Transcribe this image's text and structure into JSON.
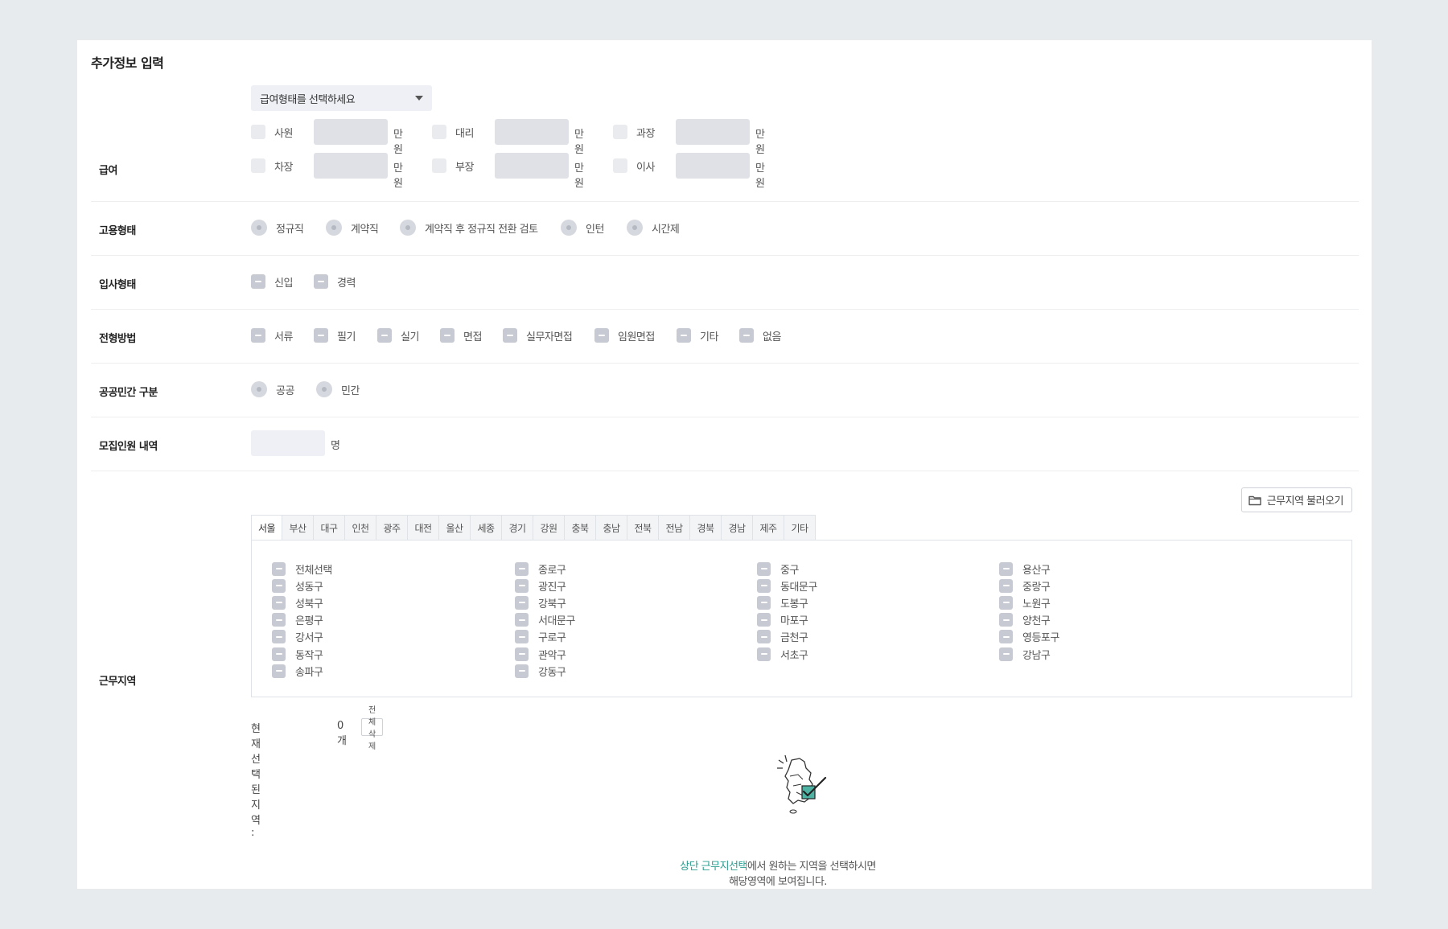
{
  "title": "추가정보 입력",
  "salary": {
    "label": "급여",
    "select_placeholder": "급여형태를 선택하세요",
    "unit": "만원",
    "ranks": [
      "사원",
      "대리",
      "과장",
      "차장",
      "부장",
      "이사"
    ]
  },
  "employment_type": {
    "label": "고용형태",
    "options": [
      "정규직",
      "계약직",
      "계약직 후 정규직 전환 검토",
      "인턴",
      "시간제"
    ]
  },
  "hire_type": {
    "label": "입사형태",
    "options": [
      "신입",
      "경력"
    ]
  },
  "screening": {
    "label": "전형방법",
    "options": [
      "서류",
      "필기",
      "실기",
      "면접",
      "실무자면접",
      "임원면접",
      "기타",
      "없음"
    ]
  },
  "sector": {
    "label": "공공민간 구분",
    "options": [
      "공공",
      "민간"
    ]
  },
  "recruit_count": {
    "label": "모집인원 내역",
    "unit": "명"
  },
  "work_region": {
    "label": "근무지역",
    "load_button": "근무지역 불러오기",
    "tabs": [
      "서울",
      "부산",
      "대구",
      "인천",
      "광주",
      "대전",
      "울산",
      "세종",
      "경기",
      "강원",
      "충북",
      "충남",
      "전북",
      "전남",
      "경북",
      "경남",
      "제주",
      "기타"
    ],
    "active_tab": "서울",
    "districts": [
      "전체선택",
      "종로구",
      "중구",
      "용산구",
      "성동구",
      "광진구",
      "동대문구",
      "중랑구",
      "성북구",
      "강북구",
      "도봉구",
      "노원구",
      "은평구",
      "서대문구",
      "마포구",
      "양천구",
      "강서구",
      "구로구",
      "금천구",
      "영등포구",
      "동작구",
      "관악구",
      "서초구",
      "강남구",
      "송파구",
      "강동구"
    ],
    "selected_label": "현재 선택된 지역 :",
    "selected_count": "0개",
    "clear_button": "전체 삭제",
    "hint_accent": "상단 근무지선택",
    "hint_rest": "에서 원하는 지역을 선택하시면",
    "hint_line2": "해당영역에 보여집니다.",
    "accent_color": "#2a9d8f"
  },
  "icons": [
    "folder-icon",
    "map-check-icon",
    "caret-down-icon"
  ]
}
